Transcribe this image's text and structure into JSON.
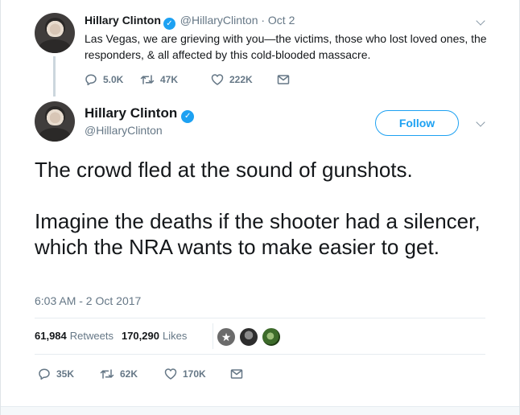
{
  "parent_tweet": {
    "name": "Hillary Clinton",
    "handle_date": "@HillaryClinton · Oct 2",
    "text": "Las Vegas, we are grieving with you—the victims, those who lost loved ones, the responders, & all affected by this cold-blooded massacre.",
    "replies": "5.0K",
    "retweets": "47K",
    "likes": "222K"
  },
  "main_tweet": {
    "name": "Hillary Clinton",
    "handle": "@HillaryClinton",
    "follow_label": "Follow",
    "text": "The crowd fled at the sound of gunshots.\n\nImagine the deaths if the shooter had a silencer, which the NRA wants to make easier to get.",
    "timestamp": "6:03 AM - 2 Oct 2017",
    "retweet_count": "61,984",
    "retweet_label": "Retweets",
    "like_count": "170,290",
    "like_label": "Likes",
    "replies": "35K",
    "retweets": "62K",
    "likes": "170K"
  },
  "colors": {
    "accent": "#1da1f2",
    "muted": "#657786",
    "text": "#14171a"
  },
  "icons": [
    "verified-badge-icon",
    "chevron-down-icon",
    "reply-icon",
    "retweet-icon",
    "like-icon",
    "direct-message-icon"
  ]
}
